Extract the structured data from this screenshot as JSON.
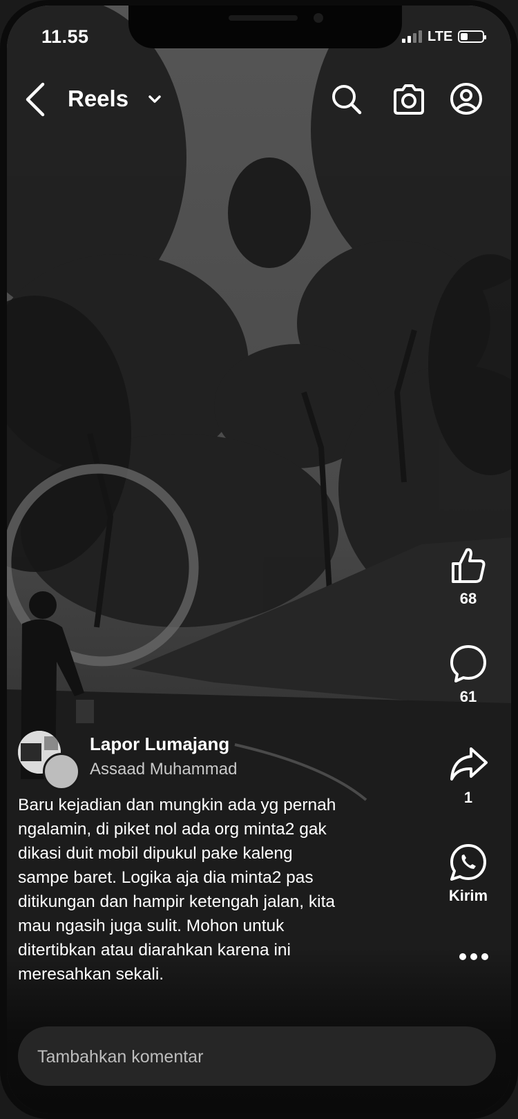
{
  "status_bar": {
    "time": "11.55",
    "network": "LTE",
    "signal_bars": 2,
    "battery_level": 0.3
  },
  "header": {
    "title": "Reels",
    "icons": [
      "back-arrow-icon",
      "chevron-down-icon",
      "search-icon",
      "camera-icon",
      "profile-icon"
    ]
  },
  "actions": {
    "like_count": "68",
    "comment_count": "61",
    "share_count": "1",
    "send_label": "Kirim"
  },
  "post": {
    "page_name": "Lapor Lumajang",
    "author_name": "Assaad Muhammad",
    "caption": "Baru kejadian dan mungkin ada yg pernah\nngalamin, di piket nol ada org minta2 gak\ndikasi duit mobil dipukul pake kaleng\nsampe baret. Logika aja dia minta2 pas\nditikungan dan hampir ketengah jalan, kita\nmau ngasih juga sulit. Mohon untuk\nditertibkan atau diarahkan karena ini\nmeresahkan sekali."
  },
  "comment": {
    "placeholder": "Tambahkan komentar"
  },
  "colors": {
    "text": "#ffffff",
    "muted_text": "#c9c9c9",
    "comment_bar": "#262626"
  }
}
